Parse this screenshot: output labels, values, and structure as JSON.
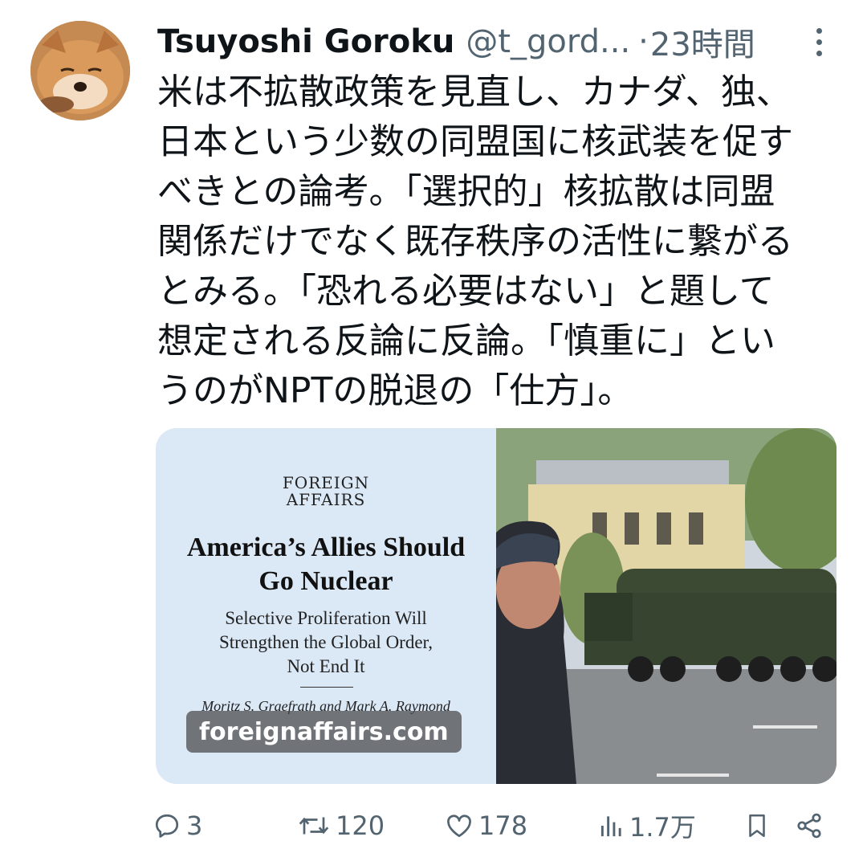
{
  "tweet": {
    "author_name": "Tsuyoshi Goroku",
    "handle": "@t_gord...",
    "separator": "·",
    "time": "23時間",
    "text": "米は不拡散政策を見直し、カナダ、独、\n日本という少数の同盟国に核武装を促す\nべきとの論考。「選択的」核拡散は同盟\n関係だけでなく既存秩序の活性に繋がる\nとみる。「恐れる必要はない」と題して\n想定される反論に反論。「慎重に」とい\nうのがNPTの脱退の「仕方」。"
  },
  "card": {
    "brand": "FOREIGN\nAFFAIRS",
    "headline": "America’s Allies Should\nGo Nuclear",
    "subheadline": "Selective Proliferation Will\nStrengthen the Global Order,\nNot End It",
    "authors": "Moritz S. Graefrath and Mark A. Raymond",
    "domain": "foreignaffairs.com"
  },
  "actions": {
    "replies": "3",
    "reposts": "120",
    "likes": "178",
    "views": "1.7万"
  },
  "icons": {
    "reply": "reply-icon",
    "repost": "repost-icon",
    "like": "heart-icon",
    "views": "views-icon",
    "bookmark": "bookmark-icon",
    "share": "share-icon",
    "more": "more-icon"
  },
  "colors": {
    "text": "#0f1419",
    "secondary": "#536471",
    "card_cover_bg": "#dbe8f6"
  }
}
